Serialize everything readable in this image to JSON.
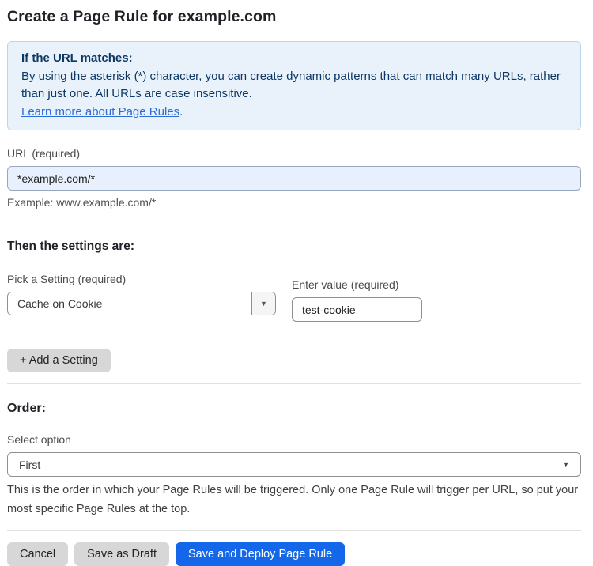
{
  "page": {
    "title": "Create a Page Rule for example.com"
  },
  "info_box": {
    "heading": "If the URL matches:",
    "body": "By using the asterisk (*) character, you can create dynamic patterns that can match many URLs, rather than just one. All URLs are case insensitive.",
    "link": "Learn more about Page Rules",
    "link_suffix": "."
  },
  "url_field": {
    "label": "URL (required)",
    "value": "*example.com/*",
    "helper": "Example: www.example.com/*"
  },
  "settings": {
    "heading": "Then the settings are:",
    "setting_label": "Pick a Setting (required)",
    "setting_value": "Cache on Cookie",
    "value_label": "Enter value (required)",
    "value_value": "test-cookie",
    "add_button": "+ Add a Setting"
  },
  "order": {
    "heading": "Order:",
    "select_label": "Select option",
    "select_value": "First",
    "helper": "This is the order in which your Page Rules will be triggered. Only one Page Rule will trigger per URL, so put your most specific Page Rules at the top."
  },
  "actions": {
    "cancel": "Cancel",
    "save_draft": "Save as Draft",
    "save_deploy": "Save and Deploy Page Rule"
  },
  "icons": {
    "dropdown_arrow": "▼"
  },
  "colors": {
    "info_bg": "#e9f2fb",
    "info_border": "#b9d6f0",
    "info_text": "#0c3866",
    "link": "#2c6cd6",
    "primary_button": "#1467e8",
    "autofill_input_bg": "#e8f0fe",
    "gray_button": "#d7d7d7"
  }
}
